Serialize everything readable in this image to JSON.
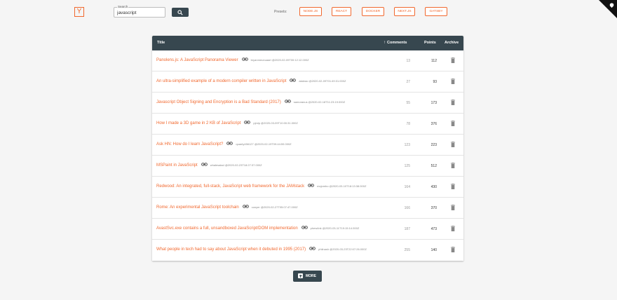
{
  "header": {
    "logo_letter": "Y",
    "search": {
      "label": "Search",
      "value": "javascript"
    },
    "presets_label": "Presets:",
    "presets": [
      "NODE.JS",
      "REACT",
      "DOCKER",
      "NEXT.JS",
      "GATSBY"
    ]
  },
  "table": {
    "columns": {
      "title": "Title",
      "comments": "Comments",
      "points": "Points",
      "archive": "Archive"
    },
    "rows": [
      {
        "title": "Panolens.js: A JavaScript Panorama Viewer",
        "meta": "bryanmeunuaart @2020-02-09T00:12:12.000Z",
        "comments": "13",
        "points": "112"
      },
      {
        "title": "An ultra-simplified example of a modern compiler written in JavaScript",
        "meta": "alakrao @2020-02-09T01:49:31.000Z",
        "comments": "27",
        "points": "93"
      },
      {
        "title": "Javascript Object Signing and Encryption is a Bad Standard (2017)",
        "meta": "samoranus @2020-02-18T11:23:19.000Z",
        "comments": "55",
        "points": "173"
      },
      {
        "title": "How I made a 3D game in 2 KB of JavaScript",
        "meta": "pjmlp @2020-03-09T10:00:31.000Z",
        "comments": "78",
        "points": "376"
      },
      {
        "title": "Ask HN: How do I learn JavaScript?",
        "meta": "quanty456127 @2020-02-19T09:44:59.000Z",
        "comments": "123",
        "points": "223"
      },
      {
        "title": "MSPaint in JavaScript",
        "meta": "whalesalad @2020-02-23T18:27:37.000Z",
        "comments": "125",
        "points": "512"
      },
      {
        "title": "Redwood: An integrated, full-stack, JavaScript web framework for the JAMstack",
        "meta": "mojombo @2020-03-10T18:13:38.000Z",
        "comments": "164",
        "points": "430"
      },
      {
        "title": "Rome: An experimental JavaScript toolchain",
        "meta": "conyer @2020-02-27T05:07:47.000Z",
        "comments": "166",
        "points": "370"
      },
      {
        "title": "AvastSvc.exe contains a full, unsandboxed JavaScript/DOM implementation",
        "meta": "phew4nk @2020-03-11T19:15:14.000Z",
        "comments": "187",
        "points": "473"
      },
      {
        "title": "What people in tech had to say about JavaScript when it debuted in 1995 (2017)",
        "meta": "philnash @2020-03-23T22:07:26.000Z",
        "comments": "255",
        "points": "140"
      }
    ]
  },
  "more_button": {
    "label": "MORE"
  },
  "colors": {
    "accent": "#f1682e",
    "header_bg": "#37474f",
    "page_bg": "#f5f5f5"
  }
}
